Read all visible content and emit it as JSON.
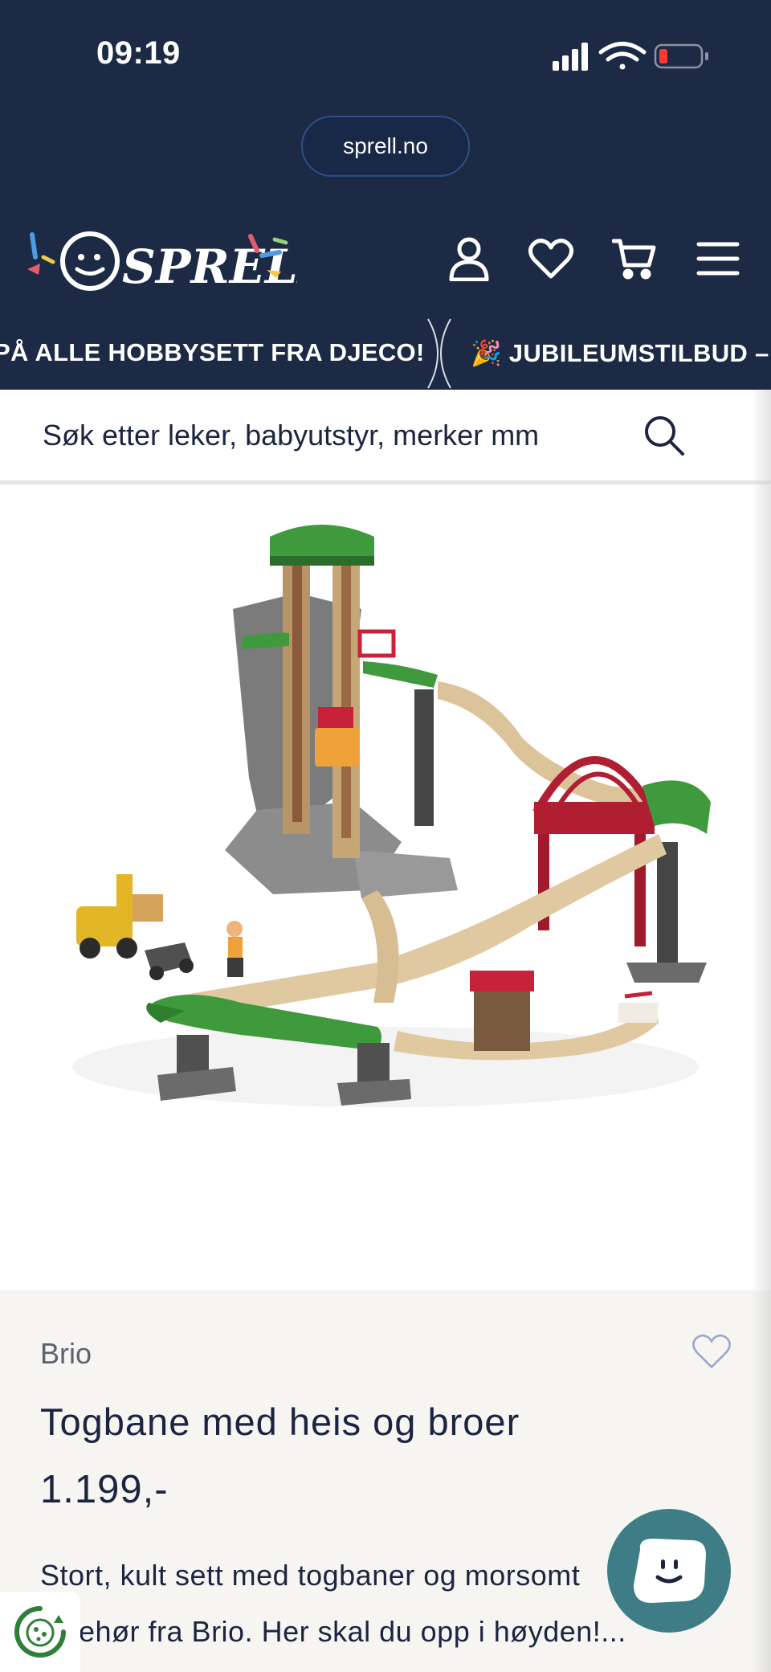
{
  "status_bar": {
    "time": "09:19"
  },
  "browser": {
    "url": "sprell.no"
  },
  "header": {
    "logo_text": "SPRELL",
    "nav_icons": [
      "account-icon",
      "heart-icon",
      "cart-icon",
      "menu-icon"
    ]
  },
  "ticker": {
    "items": [
      "PÅ ALLE HOBBYSETT FRA DJECO!",
      "🎉 JUBILEUMSTILBUD –"
    ]
  },
  "search": {
    "placeholder": "Søk etter leker, babyutstyr, merker mm"
  },
  "product": {
    "brand": "Brio",
    "title": "Togbane med heis og broer",
    "price": "1.199,-",
    "description": "Stort, kult sett med togbaner og morsomt tilbehør fra Brio. Her skal du opp i høyden!..."
  },
  "colors": {
    "header_bg": "#1c2a45",
    "info_bg": "#f6f5f2",
    "chat_bg": "#3f7d86",
    "text": "#1b2540"
  }
}
